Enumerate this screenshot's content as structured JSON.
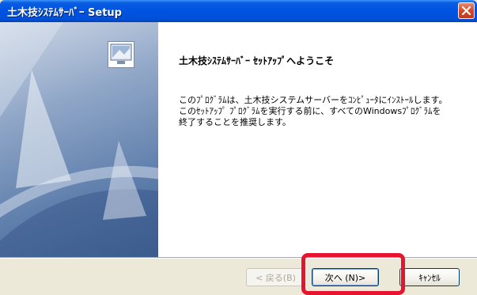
{
  "window": {
    "title": "土木技ｼｽﾃﾑｻｰﾊﾞｰ Setup"
  },
  "content": {
    "heading": "土木技ｼｽﾃﾑｻｰﾊﾞｰ ｾｯﾄｱｯﾌﾟへようこそ",
    "body_lines": [
      "このﾌﾟﾛｸﾞﾗﾑは、土木技システムサーバーをｺﾝﾋﾟｭｰﾀにｲﾝｽﾄｰﾙします。",
      "このｾｯﾄｱｯﾌﾟ ﾌﾟﾛｸﾞﾗﾑを実行する前に、すべてのWindowsﾌﾟﾛｸﾞﾗﾑを",
      "終了することを推奨します。"
    ]
  },
  "buttons": {
    "back": "< 戻る(B)",
    "next": "次へ (N)>",
    "cancel": "ｷｬﾝｾﾙ"
  },
  "colors": {
    "titlebar": "#0054e3",
    "highlight": "#e8142f",
    "window_bg": "#ece9d8"
  }
}
